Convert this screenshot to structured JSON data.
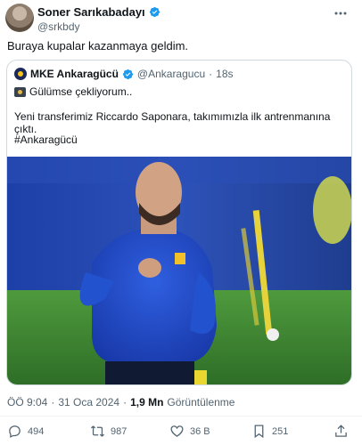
{
  "author": {
    "name": "Soner Sarıkabadayı",
    "handle": "@srkbdy"
  },
  "tweet": {
    "text": "Buraya kupalar kazanmaya geldim."
  },
  "quote": {
    "name": "MKE Ankaragücü",
    "handle": "@Ankaragucu",
    "separator": "·",
    "time": "18s",
    "line1": "Gülümse çekliyorum..",
    "line2": "Yeni transferimiz Riccardo Saponara, takımımızla ilk antrenmanına çıktı.",
    "line3": "#Ankaragücü"
  },
  "meta": {
    "time": "ÖÖ 9:04",
    "separator": "·",
    "date": "31 Oca 2024",
    "views": "1,9 Mn",
    "views_label": "Görüntülenme"
  },
  "actions": {
    "replies": "494",
    "reposts": "987",
    "likes": "36 B",
    "bookmarks": "251"
  },
  "colors": {
    "accent": "#1d9bf0",
    "text": "#0f1419",
    "muted": "#536471"
  }
}
